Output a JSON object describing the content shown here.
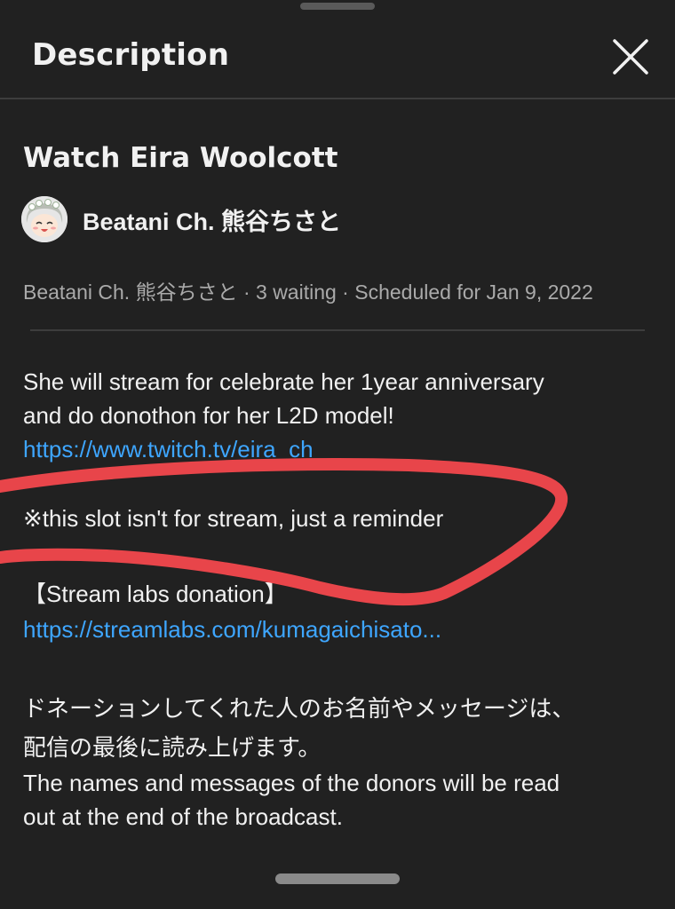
{
  "header": {
    "title": "Description"
  },
  "video": {
    "title": "Watch Eira Woolcott"
  },
  "channel": {
    "name": "Beatani Ch. 熊谷ちさと"
  },
  "meta": {
    "line": "Beatani Ch. 熊谷ちさと · 3 waiting · Scheduled for Jan 9, 2022"
  },
  "description": {
    "line1": "She will stream for celebrate her 1year anniversary",
    "line2": "and do donothon for her L2D model!",
    "twitch_link": "https://www.twitch.tv/eira_ch",
    "reminder": "※this slot isn't for stream, just a reminder",
    "dashes": "-----------",
    "streamlabs_heading": "【Stream labs donation】",
    "streamlabs_link": "https://streamlabs.com/kumagaichisato...",
    "jp_line1": "ドネーションしてくれた人のお名前やメッセージは、",
    "jp_line2": "配信の最後に読み上げます。",
    "en_line1": "The names and messages of the donors will be read",
    "en_line2": "out at the end of the broadcast."
  },
  "icons": {
    "close": "close-icon",
    "avatar": "avatar"
  },
  "colors": {
    "background": "#212121",
    "text": "#f1f1f1",
    "secondary_text": "#aaaaaa",
    "link": "#3ea6ff",
    "annotation": "#e8454a"
  }
}
